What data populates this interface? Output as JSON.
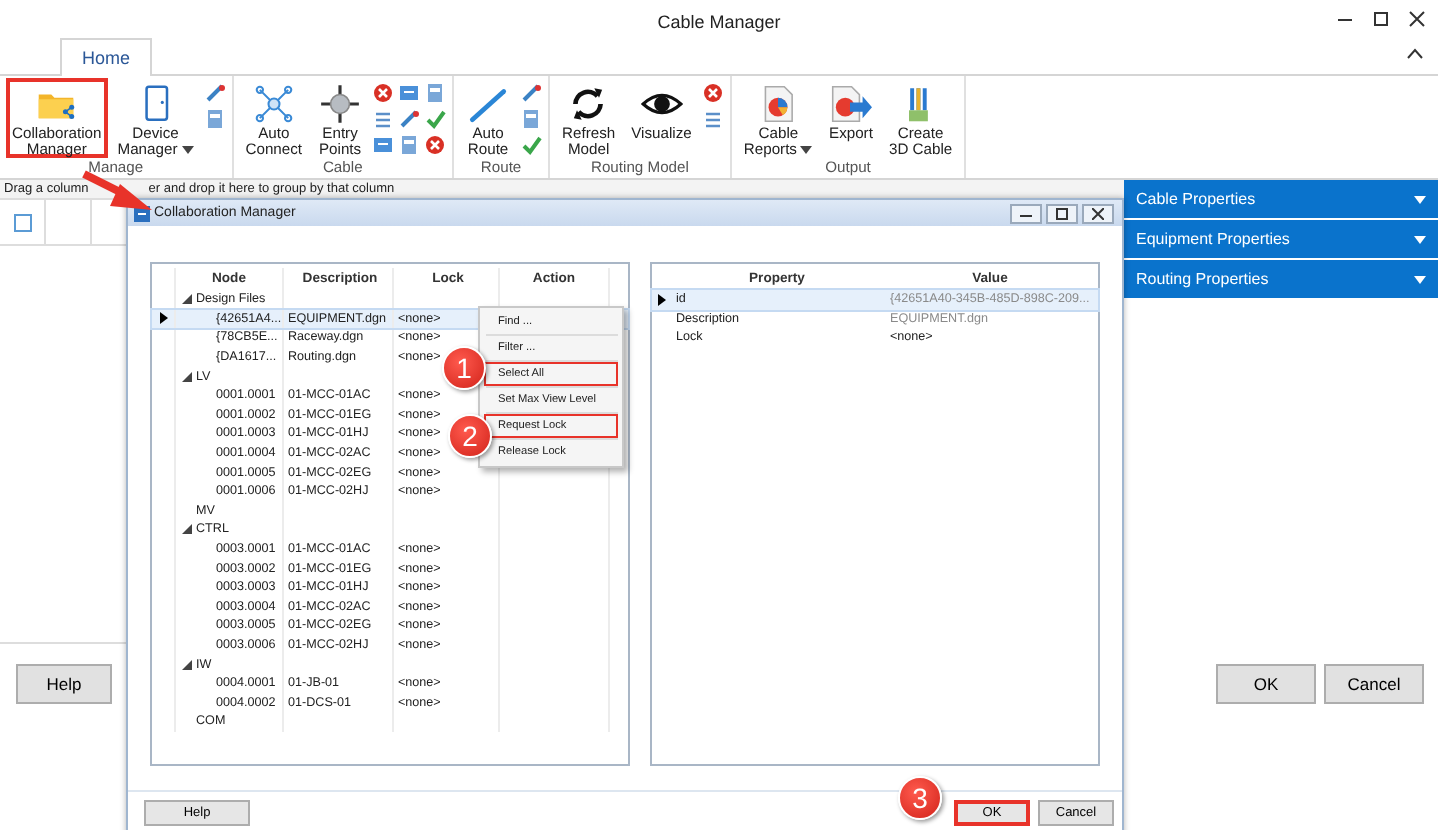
{
  "window": {
    "title": "Cable Manager"
  },
  "ribbon": {
    "tabs": [
      {
        "label": "Home",
        "selected": true
      }
    ],
    "groups": [
      {
        "label": "Manage",
        "buttons": [
          {
            "label": "Collaboration\nManager",
            "highlighted": true,
            "dropdown": false
          },
          {
            "label": "Device\nManager",
            "highlighted": false,
            "dropdown": true
          }
        ]
      },
      {
        "label": "Cable",
        "buttons": [
          {
            "label": "Auto\nConnect",
            "highlighted": false,
            "dropdown": false
          },
          {
            "label": "Entry\nPoints",
            "highlighted": false,
            "dropdown": false
          }
        ]
      },
      {
        "label": "Route",
        "buttons": [
          {
            "label": "Auto\nRoute",
            "highlighted": false,
            "dropdown": false
          }
        ]
      },
      {
        "label": "Routing Model",
        "buttons": [
          {
            "label": "Refresh\nModel",
            "highlighted": false,
            "dropdown": false
          },
          {
            "label": "Visualize",
            "highlighted": false,
            "dropdown": false
          }
        ]
      },
      {
        "label": "Output",
        "buttons": [
          {
            "label": "Cable\nReports",
            "highlighted": false,
            "dropdown": true
          },
          {
            "label": "Export",
            "highlighted": false,
            "dropdown": false
          },
          {
            "label": "Create\n3D Cable",
            "highlighted": false,
            "dropdown": false
          }
        ]
      }
    ]
  },
  "group_hint": [
    "Drag a column",
    "er and drop it here to group by that column"
  ],
  "select_all_checkbox": {
    "checked": false
  },
  "side_panels": [
    {
      "label": "Cable Properties",
      "expanded": false
    },
    {
      "label": "Equipment Properties",
      "expanded": false
    },
    {
      "label": "Routing Properties",
      "expanded": false
    }
  ],
  "main_buttons": {
    "help": "Help",
    "ok": "OK",
    "cancel": "Cancel"
  },
  "dialog": {
    "title": "Collaboration Manager",
    "columns": [
      "Node",
      "Description",
      "Lock",
      "Action"
    ],
    "tree": [
      {
        "node": "Design Files",
        "expanded": true,
        "selected": false,
        "children": [
          {
            "node": "{42651A4...",
            "description": "EQUIPMENT.dgn",
            "lock": "<none>",
            "selected": true
          },
          {
            "node": "{78CB5E...",
            "description": "Raceway.dgn",
            "lock": "<none>",
            "selected": false
          },
          {
            "node": "{DA1617...",
            "description": "Routing.dgn",
            "lock": "<none>",
            "selected": false
          }
        ]
      },
      {
        "node": "LV",
        "expanded": true,
        "selected": false,
        "children": [
          {
            "node": "0001.0001",
            "description": "01-MCC-01AC",
            "lock": "<none>",
            "selected": false
          },
          {
            "node": "0001.0002",
            "description": "01-MCC-01EG",
            "lock": "<none>",
            "selected": false
          },
          {
            "node": "0001.0003",
            "description": "01-MCC-01HJ",
            "lock": "<none>",
            "selected": false
          },
          {
            "node": "0001.0004",
            "description": "01-MCC-02AC",
            "lock": "<none>",
            "selected": false
          },
          {
            "node": "0001.0005",
            "description": "01-MCC-02EG",
            "lock": "<none>",
            "selected": false
          },
          {
            "node": "0001.0006",
            "description": "01-MCC-02HJ",
            "lock": "<none>",
            "selected": false
          }
        ]
      },
      {
        "node": "MV",
        "selected": false
      },
      {
        "node": "CTRL",
        "expanded": true,
        "selected": false,
        "children": [
          {
            "node": "0003.0001",
            "description": "01-MCC-01AC",
            "lock": "<none>",
            "selected": false
          },
          {
            "node": "0003.0002",
            "description": "01-MCC-01EG",
            "lock": "<none>",
            "selected": false
          },
          {
            "node": "0003.0003",
            "description": "01-MCC-01HJ",
            "lock": "<none>",
            "selected": false
          },
          {
            "node": "0003.0004",
            "description": "01-MCC-02AC",
            "lock": "<none>",
            "selected": false
          },
          {
            "node": "0003.0005",
            "description": "01-MCC-02EG",
            "lock": "<none>",
            "selected": false
          },
          {
            "node": "0003.0006",
            "description": "01-MCC-02HJ",
            "lock": "<none>",
            "selected": false
          }
        ]
      },
      {
        "node": "IW",
        "expanded": true,
        "selected": false,
        "children": [
          {
            "node": "0004.0001",
            "description": "01-JB-01",
            "lock": "<none>",
            "selected": false
          },
          {
            "node": "0004.0002",
            "description": "01-DCS-01",
            "lock": "<none>",
            "selected": false
          }
        ]
      },
      {
        "node": "COM",
        "selected": false
      }
    ],
    "context_menu": [
      {
        "label": "Find ...",
        "highlighted": false,
        "separator_after": true
      },
      {
        "label": "Filter ...",
        "highlighted": false,
        "separator_after": true
      },
      {
        "label": "Select All",
        "highlighted": true,
        "separator_after": true
      },
      {
        "label": "Set Max View Level",
        "highlighted": false,
        "separator_after": true
      },
      {
        "label": "Request Lock",
        "highlighted": true,
        "separator_after": true
      },
      {
        "label": "Release Lock",
        "highlighted": false,
        "separator_after": false
      }
    ],
    "property_columns": [
      "Property",
      "Value"
    ],
    "properties": [
      {
        "property": "id",
        "value": "{42651A40-345B-485D-898C-209...",
        "selected": true,
        "disabled": true
      },
      {
        "property": "Description",
        "value": "EQUIPMENT.dgn",
        "selected": false,
        "disabled": true
      },
      {
        "property": "Lock",
        "value": "<none>",
        "selected": false,
        "disabled": false
      }
    ],
    "buttons": [
      {
        "label": "Help",
        "highlighted": false
      },
      {
        "label": "OK",
        "highlighted": true
      },
      {
        "label": "Cancel",
        "highlighted": false
      }
    ]
  },
  "callouts": [
    {
      "label": "1"
    },
    {
      "label": "2"
    },
    {
      "label": "3"
    }
  ]
}
